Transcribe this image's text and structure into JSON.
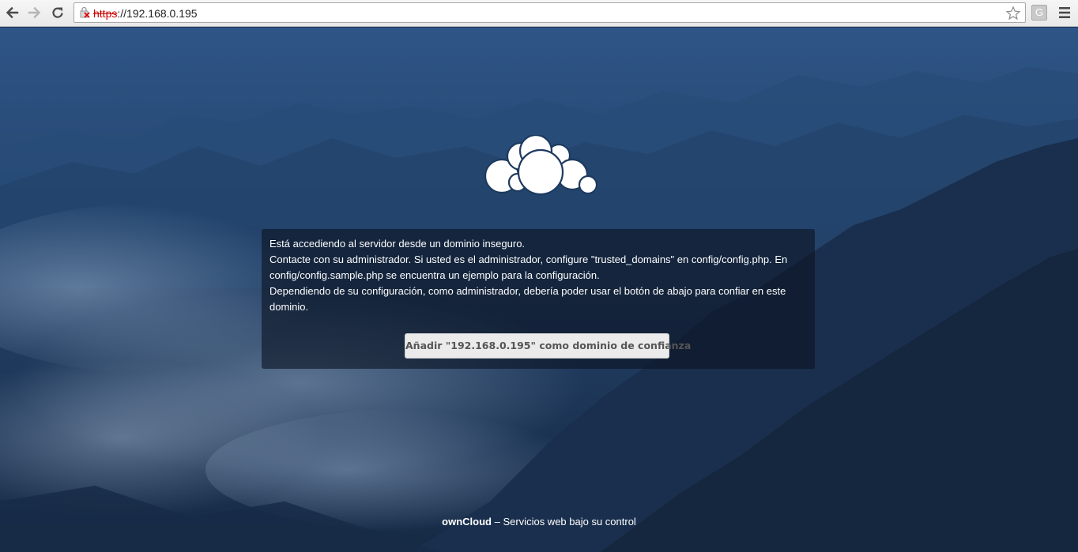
{
  "browser": {
    "url_scheme": "https",
    "url_rest": "://192.168.0.195",
    "extension_label": "G"
  },
  "warning": {
    "line1": "Está accediendo al servidor desde un dominio inseguro.",
    "line2": "Contacte con su administrador. Si usted es el administrador, configure \"trusted_domains\" en config/config.php. En config/config.sample.php se encuentra un ejemplo para la configuración.",
    "line3": "Dependiendo de su configuración, como administrador, debería poder usar el botón de abajo para confiar en este dominio.",
    "button_label": "Añadir \"192.168.0.195\" como dominio de confianza"
  },
  "footer": {
    "brand": "ownCloud",
    "tagline": " – Servicios web bajo su control"
  },
  "colors": {
    "background": "#1d3a5e",
    "panel": "#0c1422",
    "button": "#ebebeb"
  }
}
